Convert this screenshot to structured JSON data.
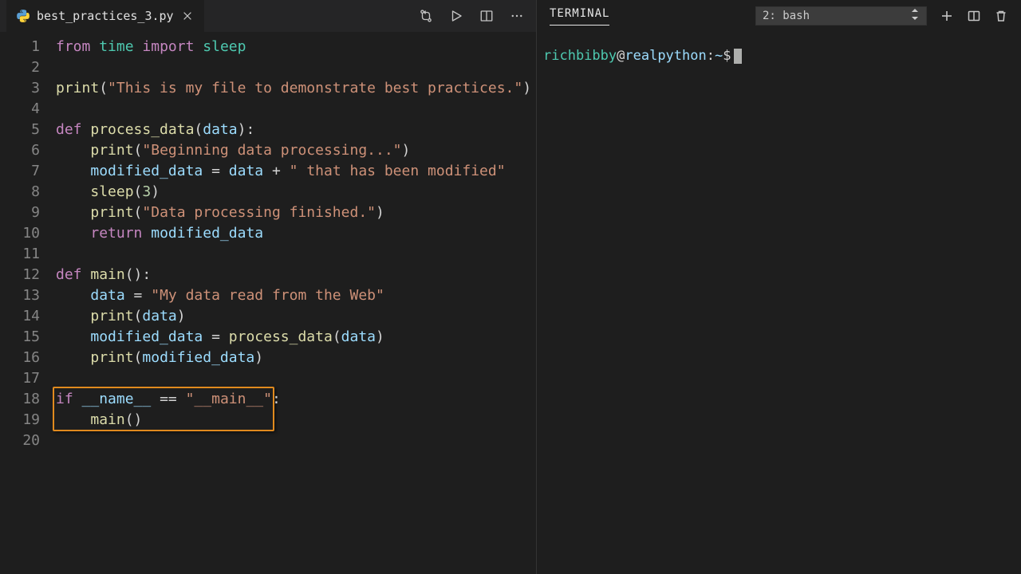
{
  "tab": {
    "filename": "best_practices_3.py"
  },
  "terminal": {
    "title": "TERMINAL",
    "selector": "2: bash",
    "prompt": {
      "user": "richbibby",
      "host": "realpython",
      "path": "~",
      "symbol": "$"
    }
  },
  "code": {
    "lines": [
      {
        "n": 1,
        "tokens": [
          [
            "kw",
            "from"
          ],
          [
            "plain",
            " "
          ],
          [
            "type",
            "time"
          ],
          [
            "plain",
            " "
          ],
          [
            "kw",
            "import"
          ],
          [
            "plain",
            " "
          ],
          [
            "type",
            "sleep"
          ]
        ]
      },
      {
        "n": 2,
        "tokens": []
      },
      {
        "n": 3,
        "tokens": [
          [
            "fn",
            "print"
          ],
          [
            "plain",
            "("
          ],
          [
            "str",
            "\"This is my file to demonstrate best practices.\""
          ],
          [
            "plain",
            ")"
          ]
        ]
      },
      {
        "n": 4,
        "tokens": []
      },
      {
        "n": 5,
        "tokens": [
          [
            "kw",
            "def"
          ],
          [
            "plain",
            " "
          ],
          [
            "fn",
            "process_data"
          ],
          [
            "plain",
            "("
          ],
          [
            "var",
            "data"
          ],
          [
            "plain",
            "):"
          ]
        ]
      },
      {
        "n": 6,
        "tokens": [
          [
            "plain",
            "    "
          ],
          [
            "fn",
            "print"
          ],
          [
            "plain",
            "("
          ],
          [
            "str",
            "\"Beginning data processing...\""
          ],
          [
            "plain",
            ")"
          ]
        ]
      },
      {
        "n": 7,
        "tokens": [
          [
            "plain",
            "    "
          ],
          [
            "var",
            "modified_data"
          ],
          [
            "plain",
            " = "
          ],
          [
            "var",
            "data"
          ],
          [
            "plain",
            " + "
          ],
          [
            "str",
            "\" that has been modified\""
          ]
        ]
      },
      {
        "n": 8,
        "tokens": [
          [
            "plain",
            "    "
          ],
          [
            "fn",
            "sleep"
          ],
          [
            "plain",
            "("
          ],
          [
            "num",
            "3"
          ],
          [
            "plain",
            ")"
          ]
        ]
      },
      {
        "n": 9,
        "tokens": [
          [
            "plain",
            "    "
          ],
          [
            "fn",
            "print"
          ],
          [
            "plain",
            "("
          ],
          [
            "str",
            "\"Data processing finished.\""
          ],
          [
            "plain",
            ")"
          ]
        ]
      },
      {
        "n": 10,
        "tokens": [
          [
            "plain",
            "    "
          ],
          [
            "kw",
            "return"
          ],
          [
            "plain",
            " "
          ],
          [
            "var",
            "modified_data"
          ]
        ]
      },
      {
        "n": 11,
        "tokens": []
      },
      {
        "n": 12,
        "tokens": [
          [
            "kw",
            "def"
          ],
          [
            "plain",
            " "
          ],
          [
            "fn",
            "main"
          ],
          [
            "plain",
            "():"
          ]
        ]
      },
      {
        "n": 13,
        "tokens": [
          [
            "plain",
            "    "
          ],
          [
            "var",
            "data"
          ],
          [
            "plain",
            " = "
          ],
          [
            "str",
            "\"My data read from the Web\""
          ]
        ]
      },
      {
        "n": 14,
        "tokens": [
          [
            "plain",
            "    "
          ],
          [
            "fn",
            "print"
          ],
          [
            "plain",
            "("
          ],
          [
            "var",
            "data"
          ],
          [
            "plain",
            ")"
          ]
        ]
      },
      {
        "n": 15,
        "tokens": [
          [
            "plain",
            "    "
          ],
          [
            "var",
            "modified_data"
          ],
          [
            "plain",
            " = "
          ],
          [
            "fn",
            "process_data"
          ],
          [
            "plain",
            "("
          ],
          [
            "var",
            "data"
          ],
          [
            "plain",
            ")"
          ]
        ]
      },
      {
        "n": 16,
        "tokens": [
          [
            "plain",
            "    "
          ],
          [
            "fn",
            "print"
          ],
          [
            "plain",
            "("
          ],
          [
            "var",
            "modified_data"
          ],
          [
            "plain",
            ")"
          ]
        ]
      },
      {
        "n": 17,
        "tokens": []
      },
      {
        "n": 18,
        "tokens": [
          [
            "kw",
            "if"
          ],
          [
            "plain",
            " "
          ],
          [
            "var",
            "__name__"
          ],
          [
            "plain",
            " == "
          ],
          [
            "str",
            "\"__main__\""
          ],
          [
            "plain",
            ":"
          ]
        ]
      },
      {
        "n": 19,
        "tokens": [
          [
            "plain",
            "    "
          ],
          [
            "fn",
            "main"
          ],
          [
            "plain",
            "()"
          ]
        ]
      },
      {
        "n": 20,
        "tokens": []
      }
    ],
    "highlight": {
      "startLine": 18,
      "endLine": 19,
      "leftPx": -4,
      "widthPx": 278
    }
  }
}
